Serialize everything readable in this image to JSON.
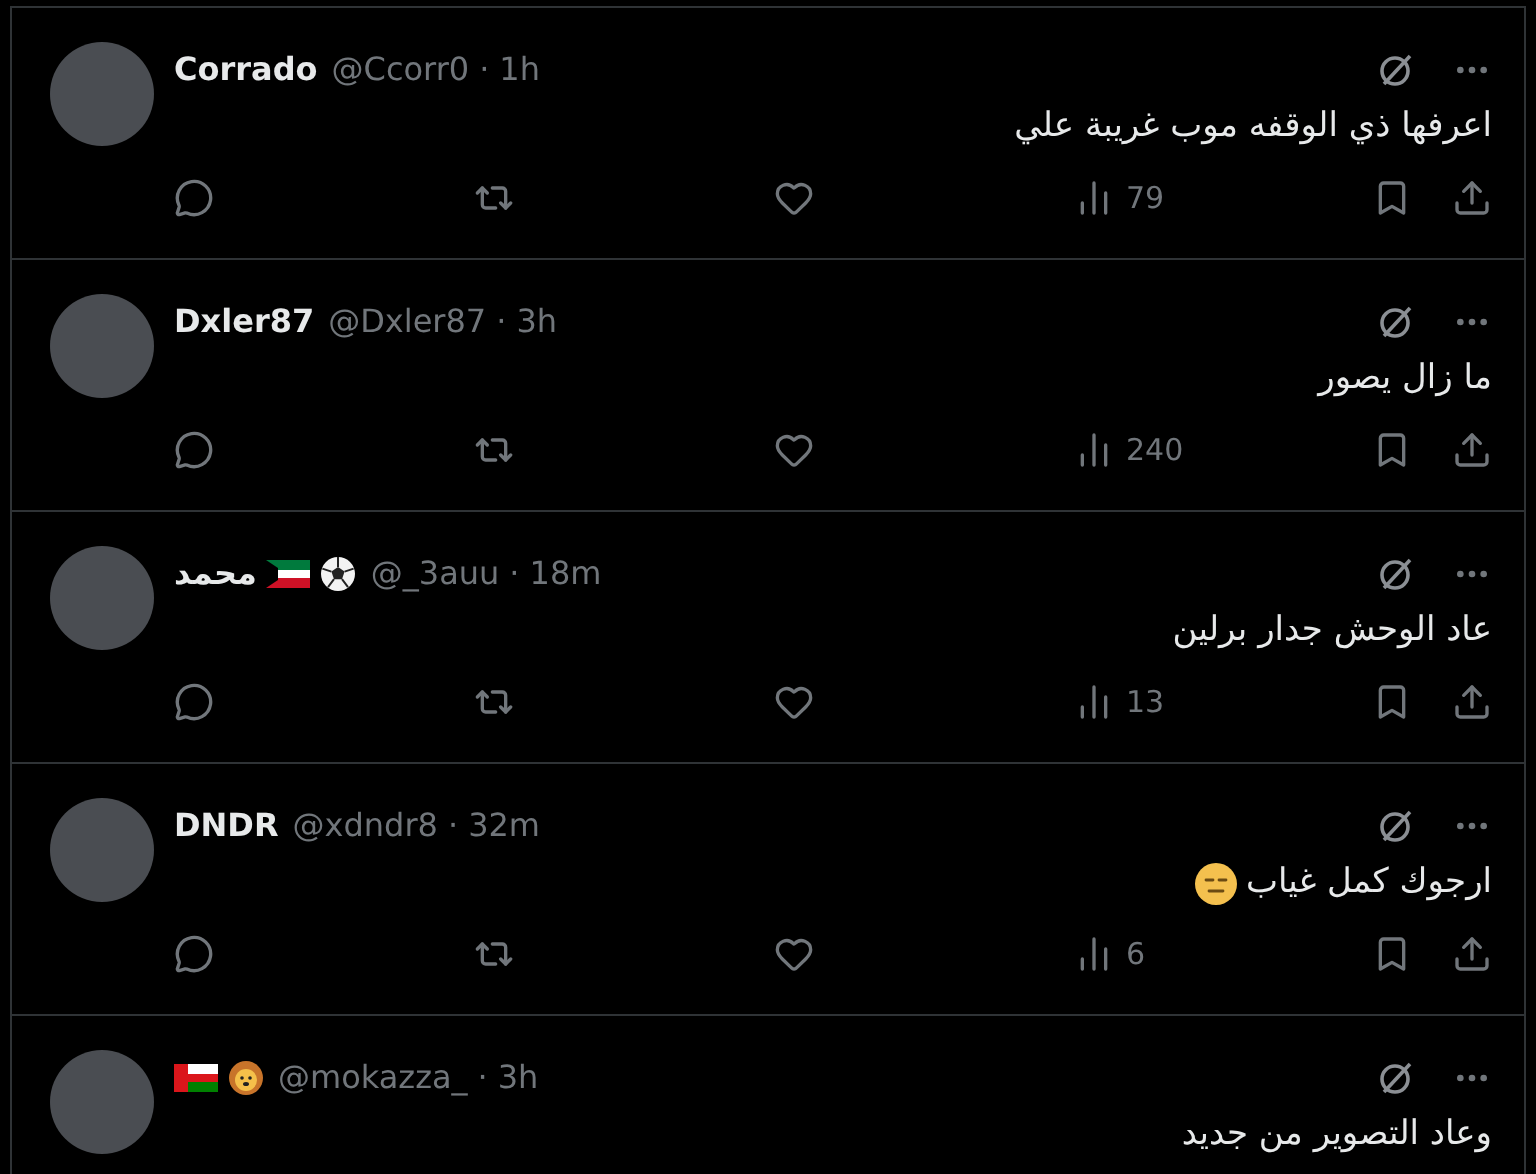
{
  "tweets": [
    {
      "name": "Corrado",
      "handle": "@Ccorr0",
      "separator": "·",
      "time": "1h",
      "text": "اعرفها ذي الوقفه موب غريبة علي",
      "views": "79"
    },
    {
      "name": "Dxler87",
      "handle": "@Dxler87",
      "separator": "·",
      "time": "3h",
      "text": "ما زال يصور",
      "views": "240"
    },
    {
      "name": "محمد",
      "badges": [
        {
          "kind": "kuwait_flag"
        },
        {
          "kind": "soccer_ball"
        }
      ],
      "handle": "@_3auu",
      "separator": "·",
      "time": "18m",
      "text": "عاد الوحش جدار برلين",
      "views": "13"
    },
    {
      "name": "DNDR",
      "handle": "@xdndr8",
      "separator": "·",
      "time": "32m",
      "text": "ارجوك كمل غياب",
      "emoji": {
        "kind": "expressionless"
      },
      "views": "6"
    },
    {
      "badges": [
        {
          "kind": "oman_flag"
        },
        {
          "kind": "lion"
        }
      ],
      "handle": "@mokazza_",
      "separator": "·",
      "time": "3h",
      "text": "وعاد التصوير من جديد"
    }
  ]
}
